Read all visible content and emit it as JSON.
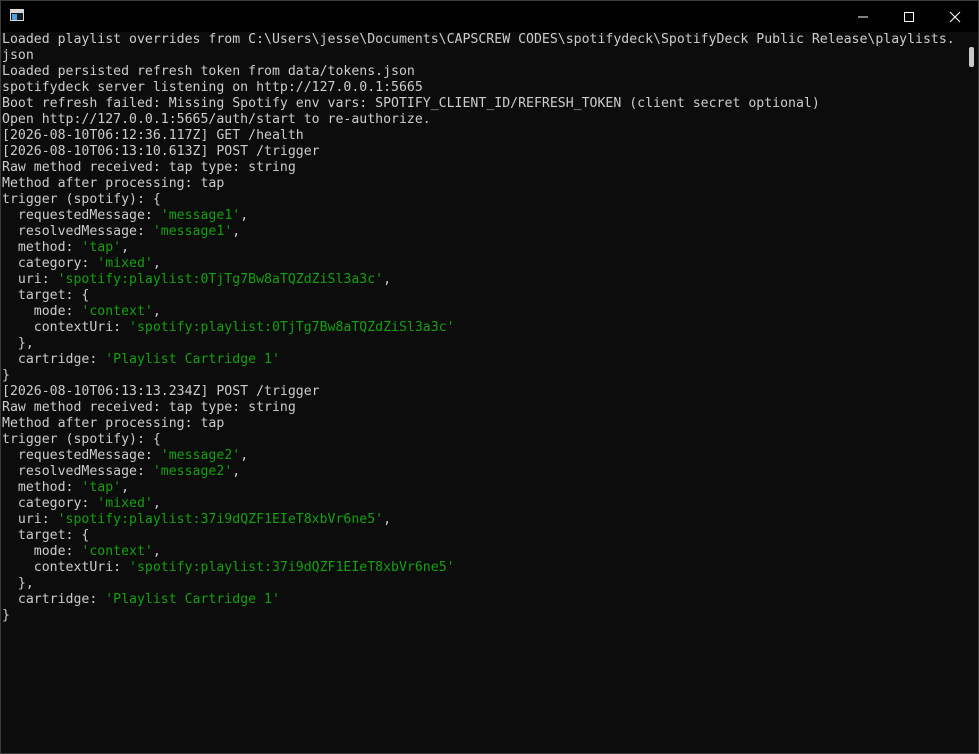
{
  "window": {
    "icon": "console-app-icon",
    "controls": {
      "minimize_icon": "minimize-icon",
      "maximize_icon": "maximize-icon",
      "close_icon": "close-icon"
    }
  },
  "colors": {
    "background": "#0c0c0c",
    "text": "#cccccc",
    "string": "#13a10e"
  },
  "console": {
    "lines": [
      {
        "segments": [
          {
            "t": "Loaded playlist overrides from C:\\Users\\jesse\\Documents\\CAPSCREW CODES\\spotifydeck\\SpotifyDeck Public Release\\playlists."
          }
        ]
      },
      {
        "segments": [
          {
            "t": "json"
          }
        ]
      },
      {
        "segments": [
          {
            "t": "Loaded persisted refresh token from data/tokens.json"
          }
        ]
      },
      {
        "segments": [
          {
            "t": "spotifydeck server listening on http://127.0.0.1:5665"
          }
        ]
      },
      {
        "segments": [
          {
            "t": "Boot refresh failed: Missing Spotify env vars: SPOTIFY_CLIENT_ID/REFRESH_TOKEN (client secret optional)"
          }
        ]
      },
      {
        "segments": [
          {
            "t": "Open http://127.0.0.1:5665/auth/start to re-authorize."
          }
        ]
      },
      {
        "segments": [
          {
            "t": "[2026-08-10T06:12:36.117Z] GET /health"
          }
        ]
      },
      {
        "segments": [
          {
            "t": "[2026-08-10T06:13:10.613Z] POST /trigger"
          }
        ]
      },
      {
        "segments": [
          {
            "t": "Raw method received: tap type: string"
          }
        ]
      },
      {
        "segments": [
          {
            "t": "Method after processing: tap"
          }
        ]
      },
      {
        "segments": [
          {
            "t": "trigger (spotify): {"
          }
        ]
      },
      {
        "segments": [
          {
            "t": "  requestedMessage: "
          },
          {
            "t": "'message1'",
            "s": true
          },
          {
            "t": ","
          }
        ]
      },
      {
        "segments": [
          {
            "t": "  resolvedMessage: "
          },
          {
            "t": "'message1'",
            "s": true
          },
          {
            "t": ","
          }
        ]
      },
      {
        "segments": [
          {
            "t": "  method: "
          },
          {
            "t": "'tap'",
            "s": true
          },
          {
            "t": ","
          }
        ]
      },
      {
        "segments": [
          {
            "t": "  category: "
          },
          {
            "t": "'mixed'",
            "s": true
          },
          {
            "t": ","
          }
        ]
      },
      {
        "segments": [
          {
            "t": "  uri: "
          },
          {
            "t": "'spotify:playlist:0TjTg7Bw8aTQZdZiSl3a3c'",
            "s": true
          },
          {
            "t": ","
          }
        ]
      },
      {
        "segments": [
          {
            "t": "  target: {"
          }
        ]
      },
      {
        "segments": [
          {
            "t": "    mode: "
          },
          {
            "t": "'context'",
            "s": true
          },
          {
            "t": ","
          }
        ]
      },
      {
        "segments": [
          {
            "t": "    contextUri: "
          },
          {
            "t": "'spotify:playlist:0TjTg7Bw8aTQZdZiSl3a3c'",
            "s": true
          }
        ]
      },
      {
        "segments": [
          {
            "t": "  },"
          }
        ]
      },
      {
        "segments": [
          {
            "t": "  cartridge: "
          },
          {
            "t": "'Playlist Cartridge 1'",
            "s": true
          }
        ]
      },
      {
        "segments": [
          {
            "t": "}"
          }
        ]
      },
      {
        "segments": [
          {
            "t": "[2026-08-10T06:13:13.234Z] POST /trigger"
          }
        ]
      },
      {
        "segments": [
          {
            "t": "Raw method received: tap type: string"
          }
        ]
      },
      {
        "segments": [
          {
            "t": "Method after processing: tap"
          }
        ]
      },
      {
        "segments": [
          {
            "t": "trigger (spotify): {"
          }
        ]
      },
      {
        "segments": [
          {
            "t": "  requestedMessage: "
          },
          {
            "t": "'message2'",
            "s": true
          },
          {
            "t": ","
          }
        ]
      },
      {
        "segments": [
          {
            "t": "  resolvedMessage: "
          },
          {
            "t": "'message2'",
            "s": true
          },
          {
            "t": ","
          }
        ]
      },
      {
        "segments": [
          {
            "t": "  method: "
          },
          {
            "t": "'tap'",
            "s": true
          },
          {
            "t": ","
          }
        ]
      },
      {
        "segments": [
          {
            "t": "  category: "
          },
          {
            "t": "'mixed'",
            "s": true
          },
          {
            "t": ","
          }
        ]
      },
      {
        "segments": [
          {
            "t": "  uri: "
          },
          {
            "t": "'spotify:playlist:37i9dQZF1EIeT8xbVr6ne5'",
            "s": true
          },
          {
            "t": ","
          }
        ]
      },
      {
        "segments": [
          {
            "t": "  target: {"
          }
        ]
      },
      {
        "segments": [
          {
            "t": "    mode: "
          },
          {
            "t": "'context'",
            "s": true
          },
          {
            "t": ","
          }
        ]
      },
      {
        "segments": [
          {
            "t": "    contextUri: "
          },
          {
            "t": "'spotify:playlist:37i9dQZF1EIeT8xbVr6ne5'",
            "s": true
          }
        ]
      },
      {
        "segments": [
          {
            "t": "  },"
          }
        ]
      },
      {
        "segments": [
          {
            "t": "  cartridge: "
          },
          {
            "t": "'Playlist Cartridge 1'",
            "s": true
          }
        ]
      },
      {
        "segments": [
          {
            "t": "}"
          }
        ]
      }
    ]
  }
}
